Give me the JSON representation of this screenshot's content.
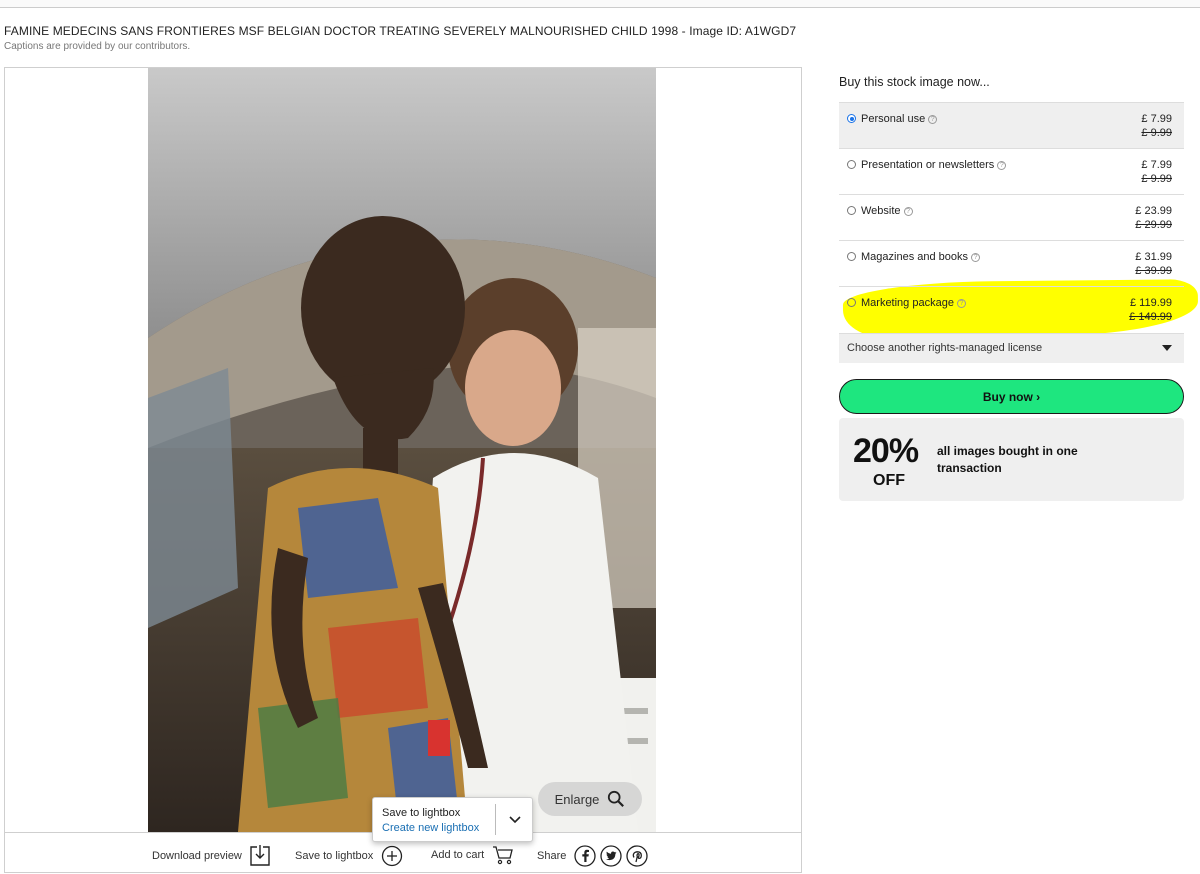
{
  "caption": {
    "title": "FAMINE MEDECINS SANS FRONTIERES MSF BELGIAN DOCTOR TREATING SEVERELY MALNOURISHED CHILD 1998 - Image ID: A1WGD7",
    "subtitle": "Captions are provided by our contributors."
  },
  "viewer": {
    "enlarge_label": "Enlarge",
    "lightbox_popup": {
      "save_label": "Save to lightbox",
      "create_label": "Create new lightbox"
    }
  },
  "actions": {
    "download": "Download preview",
    "save": "Save to lightbox",
    "cart": "Add to cart",
    "share": "Share"
  },
  "purchase": {
    "title": "Buy this stock image now...",
    "options": [
      {
        "label": "Personal use",
        "price": "£ 7.99",
        "old_price": "£ 9.99",
        "selected": true
      },
      {
        "label": "Presentation or newsletters",
        "price": "£ 7.99",
        "old_price": "£ 9.99",
        "selected": false
      },
      {
        "label": "Website",
        "price": "£ 23.99",
        "old_price": "£ 29.99",
        "selected": false
      },
      {
        "label": "Magazines and books",
        "price": "£ 31.99",
        "old_price": "£ 39.99",
        "selected": false
      },
      {
        "label": "Marketing package",
        "price": "£ 119.99",
        "old_price": "£ 149.99",
        "selected": false
      }
    ],
    "license_select": "Choose another rights-managed license",
    "buy_button": "Buy now ›",
    "promo": {
      "percent": "20%",
      "off": "OFF",
      "text": "all images bought in one transaction"
    }
  },
  "colors": {
    "buy_button": "#1ee67f",
    "highlight": "#ffff00",
    "link": "#1a6fb3",
    "radio_selected": "#1a73e8"
  }
}
